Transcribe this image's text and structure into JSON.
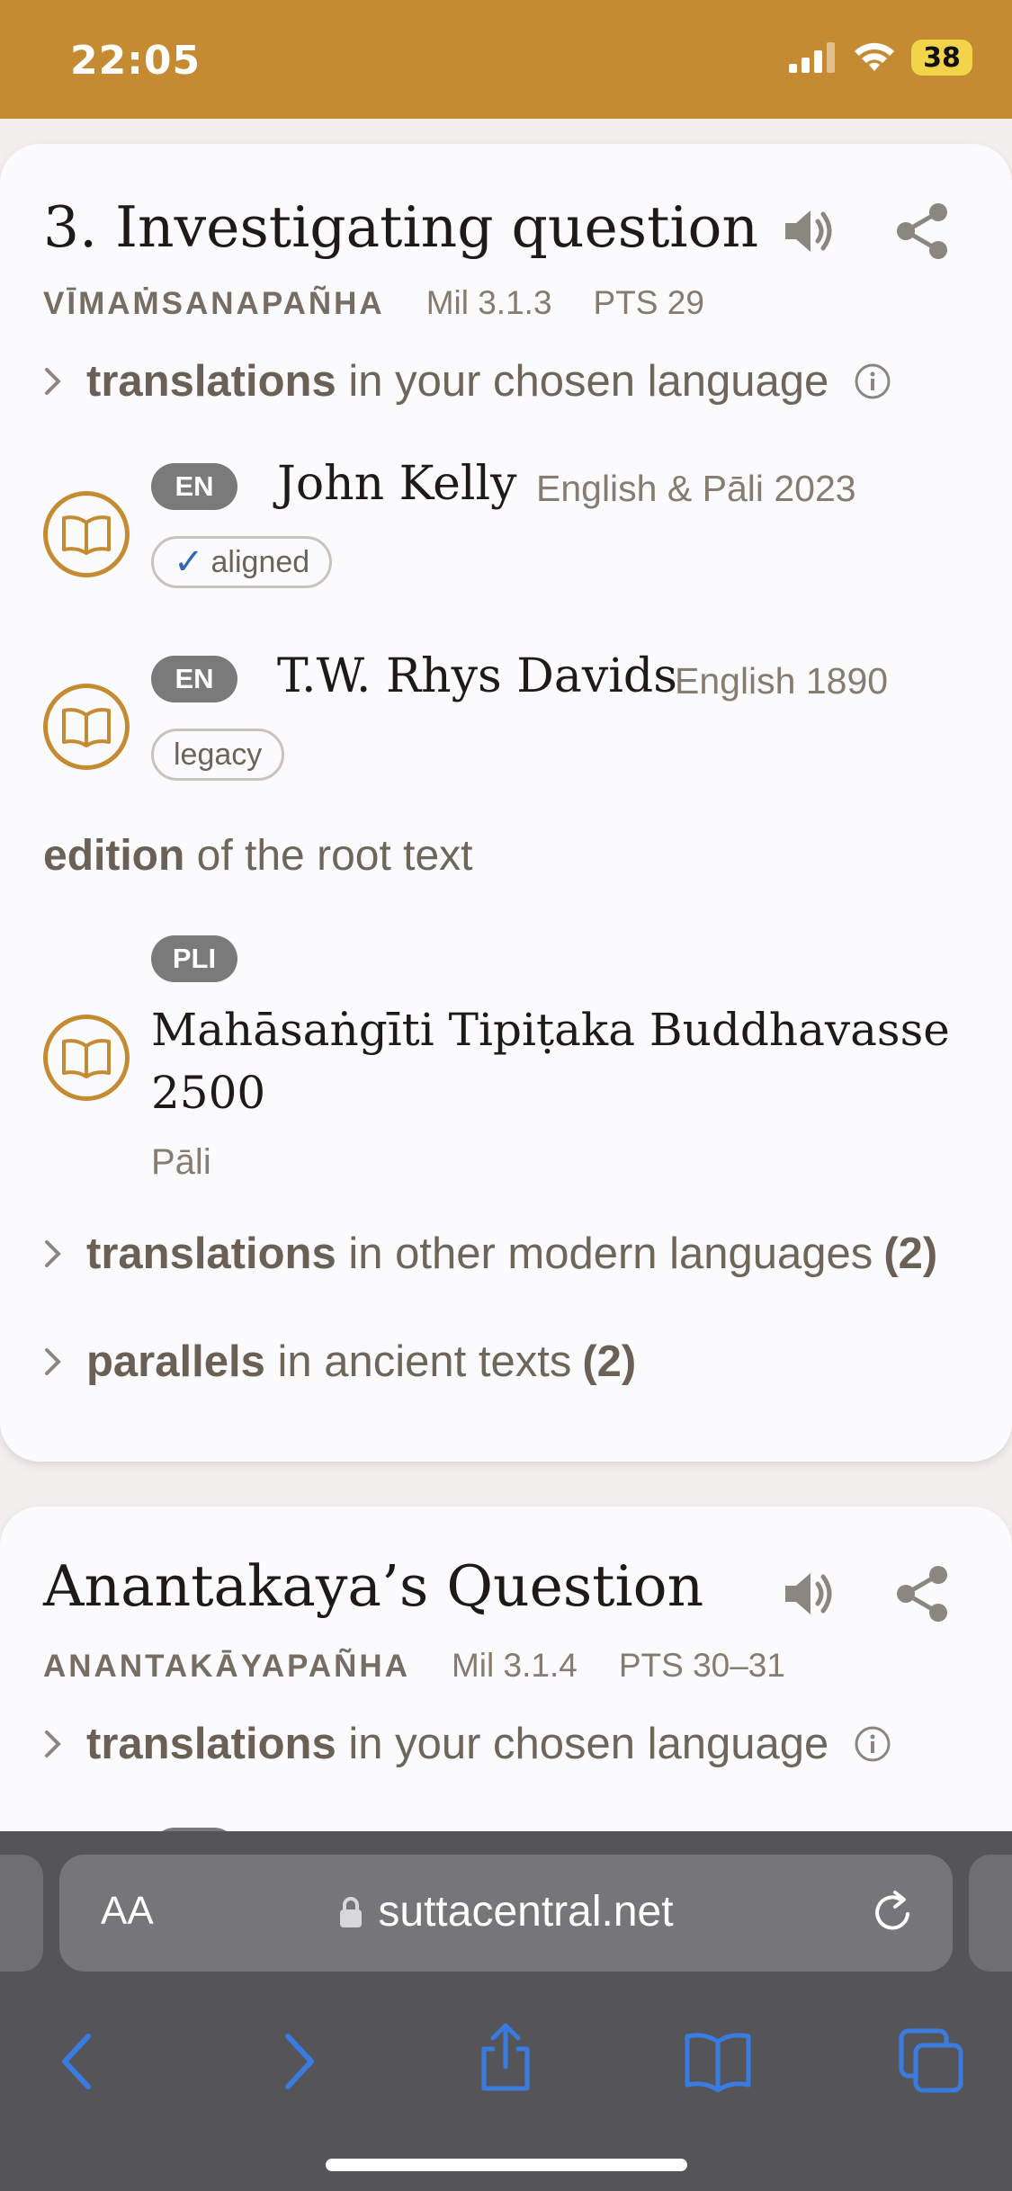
{
  "status": {
    "time": "22:05",
    "battery": "38"
  },
  "colors": {
    "accent": "#c58b32",
    "badge": "#7a7a7a",
    "link_blue": "#3a7be0"
  },
  "cards": [
    {
      "title": "3. Investigating question",
      "pali_name": "VĪMAṀSANAPAÑHA",
      "ref": "Mil 3.1.3",
      "pts": "PTS 29",
      "translations_chosen": {
        "strong": "translations",
        "rest": "in your chosen language"
      },
      "translations": [
        {
          "lang": "EN",
          "author": "John Kelly",
          "pub": "English & Pāli 2023",
          "tag": "aligned",
          "tag_check": "✓"
        },
        {
          "lang": "EN",
          "author": "T.W. Rhys Davids",
          "pub": "English 1890",
          "tag": "legacy"
        }
      ],
      "edition": {
        "strong": "edition",
        "rest": "of the root text",
        "lang": "PLI",
        "title": "Mahāsaṅgīti Tipiṭaka Buddhavasse 2500",
        "language": "Pāli"
      },
      "other_translations": {
        "strong": "translations",
        "rest": "in other modern languages",
        "count": "(2)"
      },
      "parallels": {
        "strong": "parallels",
        "rest": "in ancient texts",
        "count": "(2)"
      }
    },
    {
      "title": "Anantakaya’s Question",
      "pali_name": "ANANTAKĀYAPAÑHA",
      "ref": "Mil 3.1.4",
      "pts": "PTS 30–31",
      "translations_chosen": {
        "strong": "translations",
        "rest": "in your chosen language"
      }
    }
  ],
  "browser": {
    "text_size_label": "AA",
    "url": "suttacentral.net"
  },
  "icons": {
    "audio": "speaker-icon",
    "share": "share-icon",
    "info": "info-icon",
    "book": "book-open-icon",
    "lock": "lock-icon",
    "reload": "reload-icon"
  }
}
